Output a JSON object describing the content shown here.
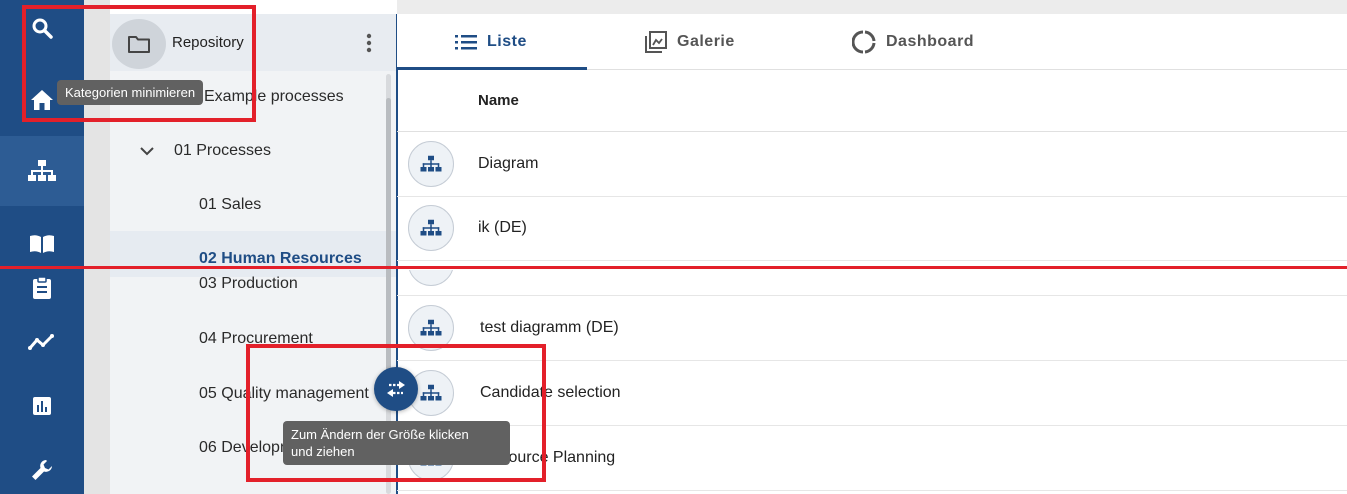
{
  "rail": {
    "items": [
      "search-icon",
      "home-icon",
      "hierarchy-icon",
      "book-icon",
      "clipboard-icon",
      "analytics-icon",
      "bar-chart-icon",
      "wrench-icon"
    ],
    "active": "hierarchy-icon",
    "color": "#1f4d85"
  },
  "category_panel": {
    "title": "Repository",
    "items": [
      {
        "label": "Example processes"
      },
      {
        "label": "01 Processes"
      },
      {
        "label": "01 Sales"
      },
      {
        "label": "02 Human Resources",
        "selected": true
      },
      {
        "label": "03 Production"
      },
      {
        "label": "04 Procurement"
      },
      {
        "label": "05 Quality management"
      },
      {
        "label": "06 Development"
      }
    ]
  },
  "tabs": [
    {
      "label": "Liste",
      "icon": "list-icon",
      "active": true
    },
    {
      "label": "Galerie",
      "icon": "gallery-icon"
    },
    {
      "label": "Dashboard",
      "icon": "donut-icon"
    }
  ],
  "table": {
    "column_header": "Name",
    "rows": [
      {
        "name": "Diagram"
      },
      {
        "name": "ik (DE)"
      },
      {
        "name": ""
      },
      {
        "name": "test diagramm (DE)"
      },
      {
        "name": "Candidate selection"
      },
      {
        "name": "Resource Planning"
      }
    ]
  },
  "tooltips": {
    "collapse": "Kategorien minimieren",
    "resize_line1": "Zum Ändern der Größe klicken",
    "resize_line2": "und ziehen"
  },
  "colors": {
    "accent": "#1f4d85",
    "annotation": "#e3202a"
  }
}
